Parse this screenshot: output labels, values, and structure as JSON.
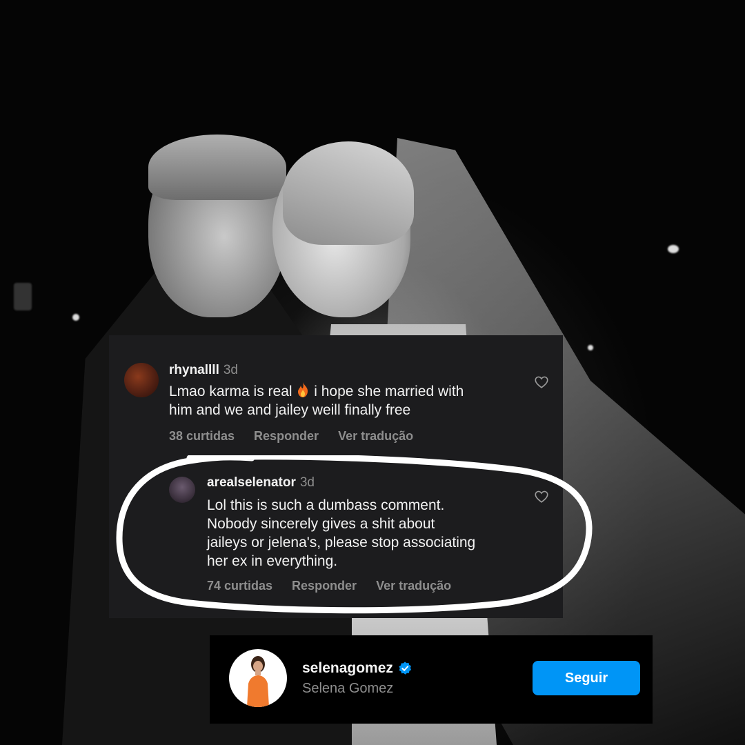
{
  "comments": [
    {
      "username": "rhynallll",
      "time": "3d",
      "text_before": "Lmao karma is real ",
      "text_after": " i hope she married with\nhim and we and jailey weill finally free",
      "emoji_icon": "fire-icon",
      "likes": "38 curtidas",
      "reply": "Responder",
      "translate": "Ver tradução"
    },
    {
      "username": "arealselenator",
      "time": "3d",
      "text": "Lol this is such a dumbass comment.\nNobody sincerely gives a shit about\njaileys or jelena's, please stop associating\nher ex in everything.",
      "likes": "74 curtidas",
      "reply": "Responder",
      "translate": "Ver tradução"
    }
  ],
  "profile": {
    "handle": "selenagomez",
    "name": "Selena Gomez",
    "verified_icon": "verified-badge-icon",
    "follow_label": "Seguir"
  },
  "colors": {
    "card_bg": "#1c1c1e",
    "text": "#f2f2f2",
    "muted": "#8e8e8e",
    "follow_blue": "#0095f6",
    "highlight_ring": "#ffffff"
  }
}
